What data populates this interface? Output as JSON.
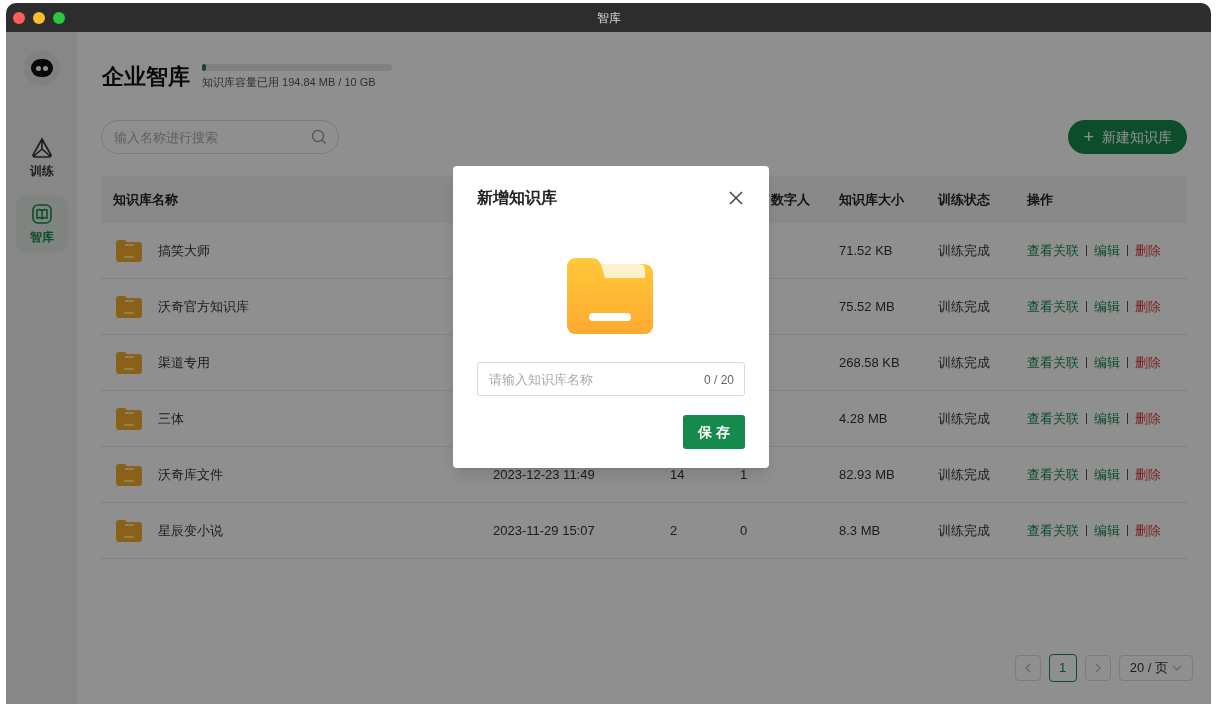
{
  "window": {
    "title": "智库"
  },
  "sidebar": {
    "items": [
      {
        "label": "训练",
        "kind": "train",
        "selected": false
      },
      {
        "label": "智库",
        "kind": "library",
        "selected": true
      }
    ]
  },
  "header": {
    "title": "企业智库",
    "storage": {
      "level": 0.02,
      "text": "知识库容量已用 194.84 MB / 10 GB"
    }
  },
  "search": {
    "placeholder": "输入名称进行搜索"
  },
  "new_button": {
    "icon": "+",
    "label": "新建知识库"
  },
  "table": {
    "columns": [
      "知识库名称",
      "",
      "",
      "数字人",
      "知识库大小",
      "训练状态",
      "操作"
    ],
    "rows": [
      {
        "name": "搞笑大师",
        "size": "71.52 KB",
        "status": "训练完成",
        "actions": [
          "查看关联",
          "编辑",
          "删除"
        ]
      },
      {
        "name": "沃奇官方知识库",
        "size": "75.52 MB",
        "status": "训练完成",
        "actions": [
          "查看关联",
          "编辑",
          "删除"
        ]
      },
      {
        "name": "渠道专用",
        "size": "268.58 KB",
        "status": "训练完成",
        "actions": [
          "查看关联",
          "编辑",
          "删除"
        ]
      },
      {
        "name": "三体",
        "size": "4.28 MB",
        "status": "训练完成",
        "actions": [
          "查看关联",
          "编辑",
          "删除"
        ]
      },
      {
        "name": "沃奇库文件",
        "date": "2023-12-23 11:49",
        "count": "14",
        "digital": "1",
        "size": "82.93 MB",
        "status": "训练完成",
        "actions": [
          "查看关联",
          "编辑",
          "删除"
        ]
      },
      {
        "name": "星辰变小说",
        "date": "2023-11-29 15:07",
        "count": "2",
        "digital": "0",
        "size": "8.3 MB",
        "status": "训练完成",
        "actions": [
          "查看关联",
          "编辑",
          "删除"
        ]
      }
    ]
  },
  "pagination": {
    "pages": [
      {
        "label": "1",
        "selected": true
      }
    ],
    "page_size": "20 / 页"
  },
  "dialog": {
    "title": "新增知识库",
    "input": {
      "placeholder": "请输入知识库名称",
      "counter": "0 / 20"
    },
    "save_button": "保 存"
  }
}
